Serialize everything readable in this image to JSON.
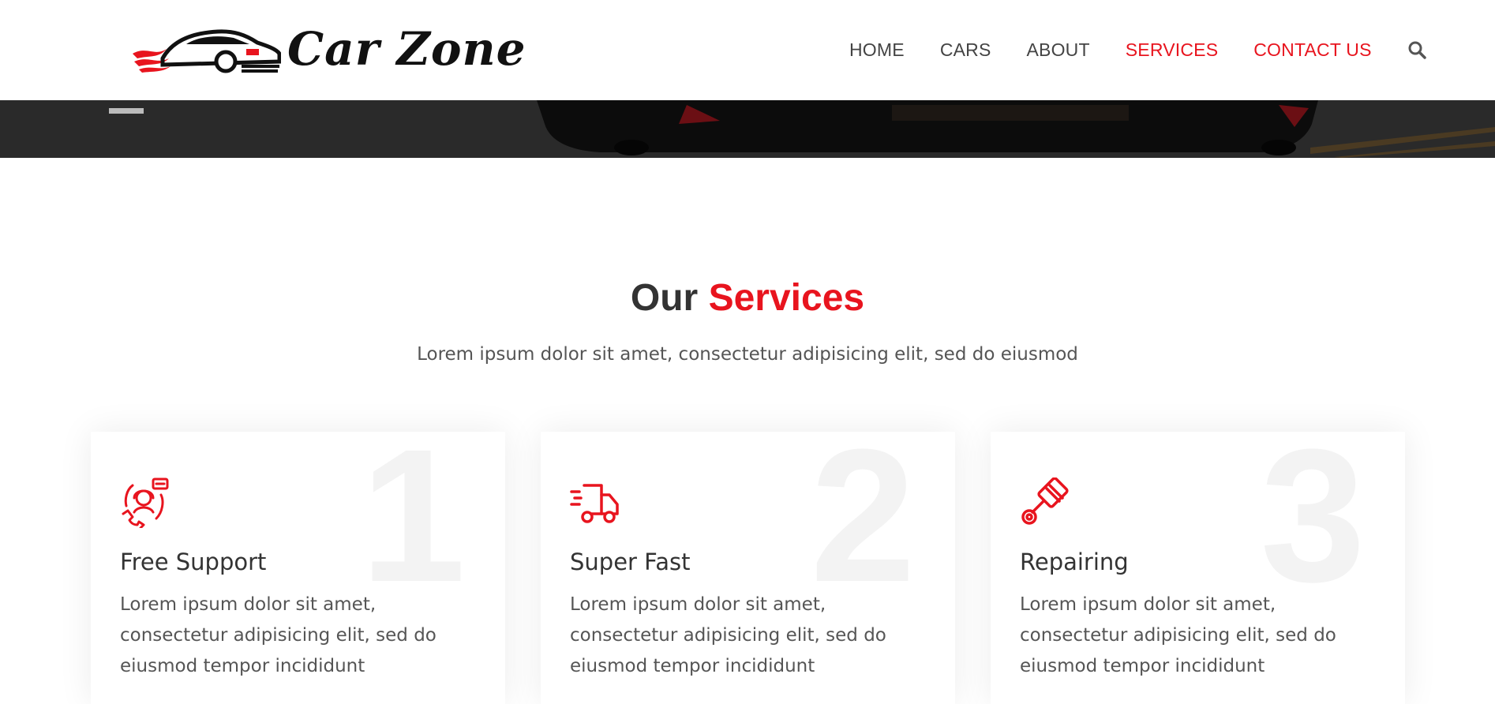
{
  "brand": {
    "name": "Car Zone"
  },
  "nav": {
    "items": [
      {
        "label": "HOME",
        "active": false
      },
      {
        "label": "CARS",
        "active": false
      },
      {
        "label": "ABOUT",
        "active": false
      },
      {
        "label": "SERVICES",
        "active": true
      },
      {
        "label": "CONTACT US",
        "active": true
      }
    ],
    "search_icon": "search-icon"
  },
  "colors": {
    "accent": "#e8141e",
    "text_dark": "#333333",
    "text_muted": "#555555"
  },
  "services": {
    "title_prefix": "Our",
    "title_accent": "Services",
    "subtitle": "Lorem ipsum dolor sit amet, consectetur adipisicing elit, sed do eiusmod",
    "cards": [
      {
        "number": "1",
        "icon": "customer-support-icon",
        "title": "Free Support",
        "description": "Lorem ipsum dolor sit amet, consectetur adipisicing elit, sed do eiusmod tempor incididunt"
      },
      {
        "number": "2",
        "icon": "delivery-truck-icon",
        "title": "Super Fast",
        "description": "Lorem ipsum dolor sit amet, consectetur adipisicing elit, sed do eiusmod tempor incididunt"
      },
      {
        "number": "3",
        "icon": "piston-repair-icon",
        "title": "Repairing",
        "description": "Lorem ipsum dolor sit amet, consectetur adipisicing elit, sed do eiusmod tempor incididunt"
      }
    ]
  }
}
